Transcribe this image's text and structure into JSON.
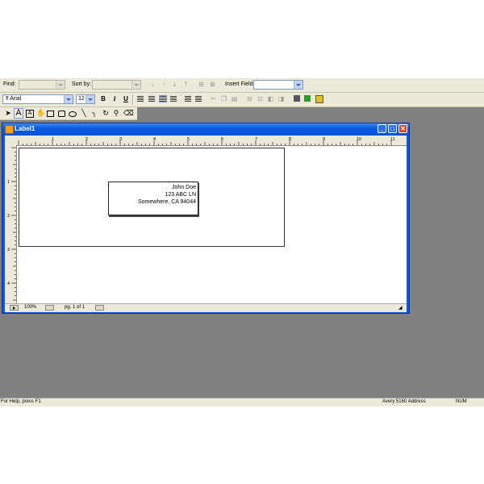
{
  "toolbar1": {
    "find_label": "Find:",
    "find_value": "",
    "sort_label": "Sort by:",
    "sort_value": "",
    "insert_field_label": "Insert Field:",
    "insert_field_value": ""
  },
  "toolbar2": {
    "font_name": "Arial",
    "font_size": "12",
    "bold": "B",
    "italic": "I",
    "underline": "U"
  },
  "window": {
    "title": "Label1",
    "minimize": "_",
    "maximize": "□",
    "close": "✕"
  },
  "ruler": {
    "h_ticks": [
      "1",
      "2",
      "3",
      "4",
      "5",
      "6",
      "7",
      "8",
      "9",
      "10",
      "11"
    ],
    "v_ticks": [
      "1",
      "2",
      "3",
      "4"
    ]
  },
  "label": {
    "line1": "John Doe",
    "line2": "123 ABC LN",
    "line3": "Somewhere, CA 94044"
  },
  "doc_status": {
    "zoom": "100%",
    "page": "pg. 1 of 1"
  },
  "app_status": {
    "help": "For Help, press F1",
    "label_type": "Avery 5160 Address",
    "num": "NUM"
  },
  "colors": {
    "titlebar": "#0a5ae3",
    "workspace": "#808080",
    "toolbar": "#ece9d8"
  }
}
